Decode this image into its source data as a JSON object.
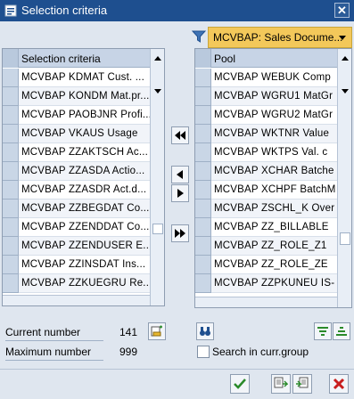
{
  "window": {
    "title": "Selection criteria",
    "close_label": "✕"
  },
  "pool_dropdown": {
    "selected": "MCVBAP: Sales Docume..."
  },
  "left_table": {
    "header": "Selection criteria",
    "rows": [
      "MCVBAP  KDMAT  Cust. ...",
      "MCVBAP  KONDM  Mat.pr...",
      "MCVBAP  PAOBJNR  Profi...",
      "MCVBAP  VKAUS  Usage",
      "MCVBAP  ZZAKTSCH  Ac...",
      "MCVBAP  ZZASDA  Actio...",
      "MCVBAP  ZZASDR  Act.d...",
      "MCVBAP  ZZBEGDAT  Co...",
      "MCVBAP  ZZENDDAT  Co...",
      "MCVBAP  ZZENDUSER  E...",
      "MCVBAP  ZZINSDAT  Ins...",
      "MCVBAP  ZZKUEGRU  Re..."
    ]
  },
  "right_table": {
    "header": "Pool",
    "rows": [
      "MCVBAP  WEBUK  Comp",
      "MCVBAP  WGRU1  MatGr",
      "MCVBAP  WGRU2  MatGr",
      "MCVBAP  WKTNR  Value",
      "MCVBAP  WKTPS  Val. c",
      "MCVBAP  XCHAR  Batche",
      "MCVBAP  XCHPF  BatchM",
      "MCVBAP  ZSCHL_K  Over",
      "MCVBAP  ZZ_BILLABLE",
      "MCVBAP  ZZ_ROLE_Z1",
      "MCVBAP  ZZ_ROLE_ZE",
      "MCVBAP  ZZPKUNEU  IS-"
    ]
  },
  "counts": {
    "current_label": "Current number",
    "current_value": "141",
    "maximum_label": "Maximum number",
    "maximum_value": "999"
  },
  "search_checkbox_label": "Search in curr.group",
  "colors": {
    "title_bar": "#1e4f8f",
    "accent_yellow": "#f3c85a"
  }
}
